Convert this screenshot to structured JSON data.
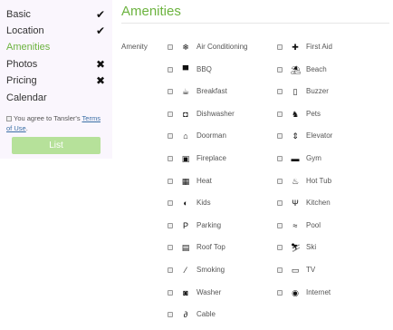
{
  "sidebar": {
    "steps": [
      {
        "label": "Basic",
        "status": "✔"
      },
      {
        "label": "Location",
        "status": "✔"
      },
      {
        "label": "Amenities",
        "status": ""
      },
      {
        "label": "Photos",
        "status": "✖"
      },
      {
        "label": "Pricing",
        "status": "✖"
      },
      {
        "label": "Calendar",
        "status": ""
      }
    ],
    "terms_prefix": "You agree to Tansler's ",
    "terms_link": "Terms of Use",
    "terms_suffix": ".",
    "list_button": "List",
    "active_color": "#6cb33f",
    "button_color": "#b6e19a"
  },
  "main": {
    "title": "Amenities",
    "amenity_label": "Amenity",
    "left_items": [
      {
        "label": "Air Conditioning",
        "icon": "snowflake-icon",
        "glyph": "❄"
      },
      {
        "label": "BBQ",
        "icon": "grill-icon",
        "glyph": "▀"
      },
      {
        "label": "Breakfast",
        "icon": "coffee-icon",
        "glyph": "☕"
      },
      {
        "label": "Dishwasher",
        "icon": "dishwasher-icon",
        "glyph": "◘"
      },
      {
        "label": "Doorman",
        "icon": "bell-icon",
        "glyph": "⌂"
      },
      {
        "label": "Fireplace",
        "icon": "fireplace-icon",
        "glyph": "▣"
      },
      {
        "label": "Heat",
        "icon": "heater-icon",
        "glyph": "▦"
      },
      {
        "label": "Kids",
        "icon": "kids-icon",
        "glyph": "◐"
      },
      {
        "label": "Parking",
        "icon": "parking-icon",
        "glyph": "P"
      },
      {
        "label": "Roof Top",
        "icon": "rooftop-icon",
        "glyph": "▤"
      },
      {
        "label": "Smoking",
        "icon": "smoking-icon",
        "glyph": "⁄"
      },
      {
        "label": "Washer",
        "icon": "washer-icon",
        "glyph": "◙"
      },
      {
        "label": "Cable",
        "icon": "cable-icon",
        "glyph": "∂"
      }
    ],
    "right_items": [
      {
        "label": "First Aid",
        "icon": "first-aid-icon",
        "glyph": "✚"
      },
      {
        "label": "Beach",
        "icon": "beach-icon",
        "glyph": "⛱"
      },
      {
        "label": "Buzzer",
        "icon": "buzzer-icon",
        "glyph": "▯"
      },
      {
        "label": "Pets",
        "icon": "pets-icon",
        "glyph": "♞"
      },
      {
        "label": "Elevator",
        "icon": "elevator-icon",
        "glyph": "⇕"
      },
      {
        "label": "Gym",
        "icon": "dumbbell-icon",
        "glyph": "▬"
      },
      {
        "label": "Hot Tub",
        "icon": "hot-tub-icon",
        "glyph": "♨"
      },
      {
        "label": "Kitchen",
        "icon": "utensils-icon",
        "glyph": "Ψ"
      },
      {
        "label": "Pool",
        "icon": "pool-icon",
        "glyph": "≈"
      },
      {
        "label": "Ski",
        "icon": "ski-icon",
        "glyph": "⛷"
      },
      {
        "label": "TV",
        "icon": "tv-icon",
        "glyph": "▭"
      },
      {
        "label": "Internet",
        "icon": "wifi-icon",
        "glyph": "◉"
      }
    ]
  }
}
